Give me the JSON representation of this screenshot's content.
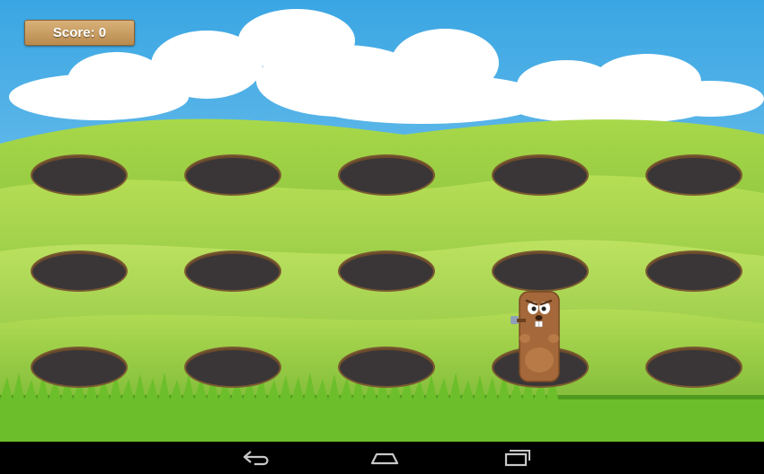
{
  "hud": {
    "score_text": "Score: 0"
  },
  "board": {
    "rows": 3,
    "cols": 5,
    "mole_position": {
      "row": 3,
      "col": 4
    }
  },
  "navigation": {
    "buttons": [
      {
        "name": "back",
        "icon": "back-arrow-icon"
      },
      {
        "name": "home",
        "icon": "home-icon"
      },
      {
        "name": "recent-apps",
        "icon": "recent-apps-icon"
      }
    ]
  },
  "colors": {
    "sky": "#4fb4e6",
    "grass": "#7cc23a",
    "hole": "#3a3638",
    "mole": "#a4683a",
    "score_plank": "#c89a5e"
  }
}
